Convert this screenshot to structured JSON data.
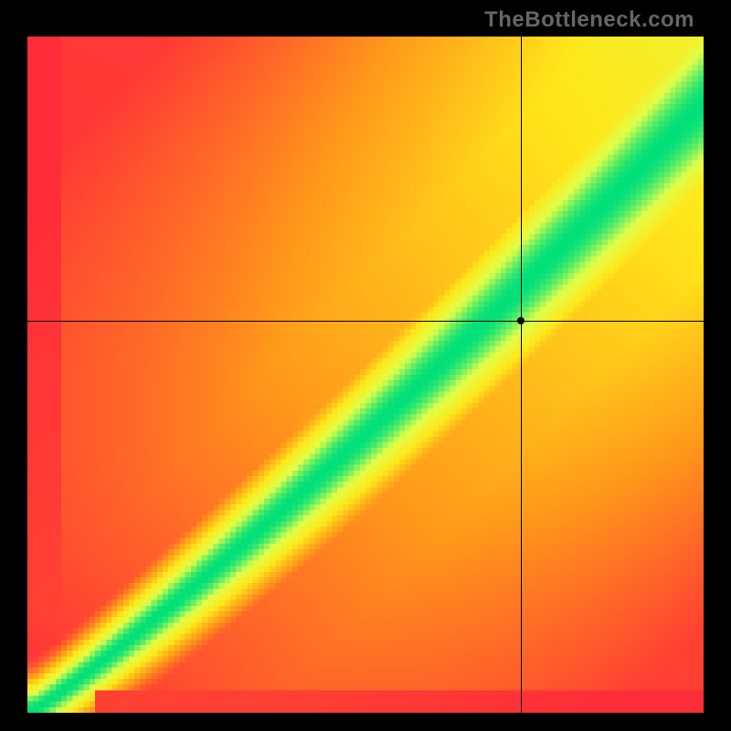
{
  "watermark": "TheBottleneck.com",
  "chart_data": {
    "type": "heatmap",
    "title": "",
    "xlabel": "",
    "ylabel": "",
    "xlim": [
      0,
      100
    ],
    "ylim": [
      0,
      100
    ],
    "grid": false,
    "legend_position": "none",
    "color_stops": {
      "low": "#ff2a3a",
      "mid_low": "#ff9a1a",
      "mid": "#ffe81a",
      "mid_high": "#e0ff4a",
      "high": "#00e07a"
    },
    "description": "Compatibility heatmap. Value is highest (green) along a near-diagonal band from origin to (100,~80). Cells far from the band fade through yellow/orange to red.",
    "marker": {
      "x": 73,
      "y": 58
    },
    "crosshair": {
      "x": 73,
      "y": 58
    },
    "pixel_grid_resolution": 120
  }
}
